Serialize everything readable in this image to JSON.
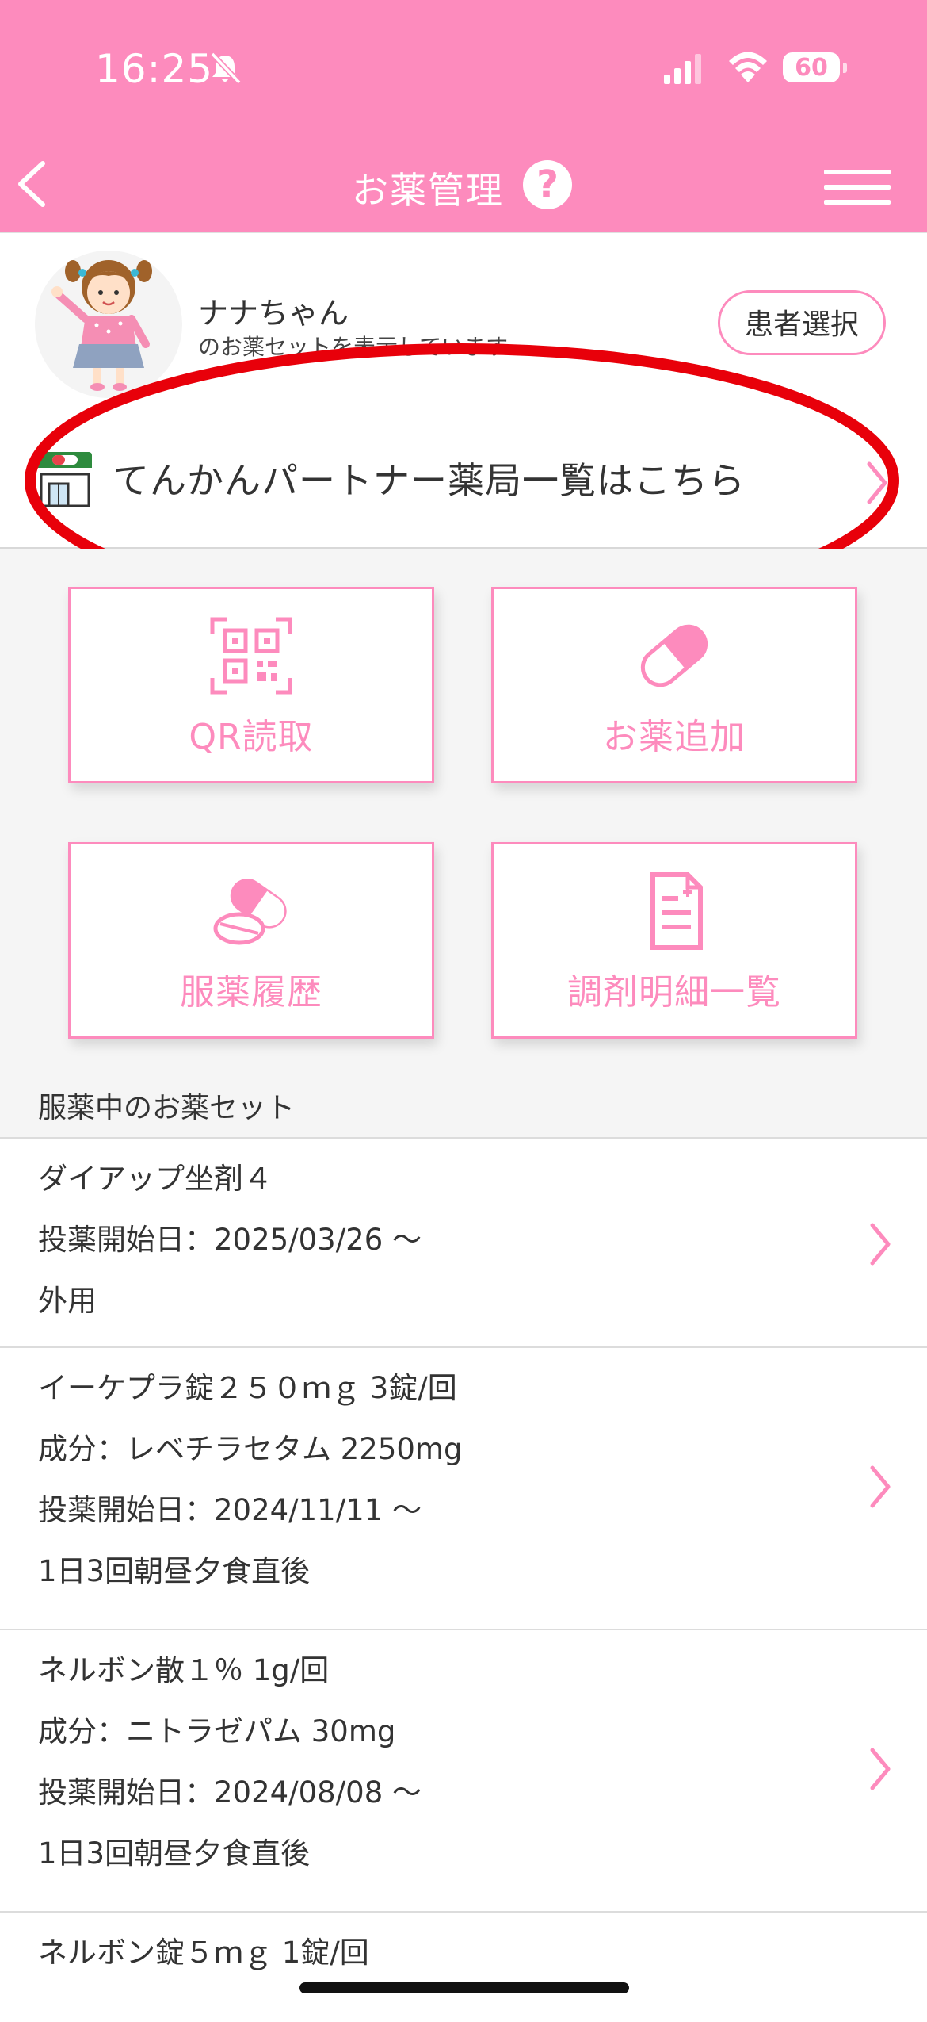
{
  "status_bar": {
    "time": "16:25",
    "battery": "60"
  },
  "nav": {
    "title": "お薬管理"
  },
  "patient": {
    "name": "ナナちゃん",
    "subtitle": "のお薬セットを表示しています",
    "select_button": "患者選択"
  },
  "pharmacy_link": {
    "label": "てんかんパートナー薬局一覧はこちら"
  },
  "tiles": [
    {
      "label": "QR読取",
      "icon": "qr-code-icon"
    },
    {
      "label": "お薬追加",
      "icon": "capsule-icon"
    },
    {
      "label": "服薬履歴",
      "icon": "pills-icon"
    },
    {
      "label": "調剤明細一覧",
      "icon": "document-icon"
    }
  ],
  "section": {
    "title": "服薬中のお薬セット"
  },
  "medications": [
    {
      "lines": [
        "ダイアップ坐剤４",
        "投薬開始日：2025/03/26 〜",
        "外用"
      ]
    },
    {
      "lines": [
        "イーケプラ錠２５０ｍｇ 3錠/回",
        "成分：レベチラセタム 2250mg",
        "投薬開始日：2024/11/11 〜",
        "1日3回朝昼夕食直後"
      ]
    },
    {
      "lines": [
        "ネルボン散１％ 1g/回",
        "成分：ニトラゼパム 30mg",
        "投薬開始日：2024/08/08 〜",
        "1日3回朝昼夕食直後"
      ]
    },
    {
      "lines": [
        "ネルボン錠５ｍｇ 1錠/回"
      ]
    }
  ],
  "colors": {
    "brand_pink": "#fd8bbd",
    "highlight_red": "#e8000a"
  }
}
